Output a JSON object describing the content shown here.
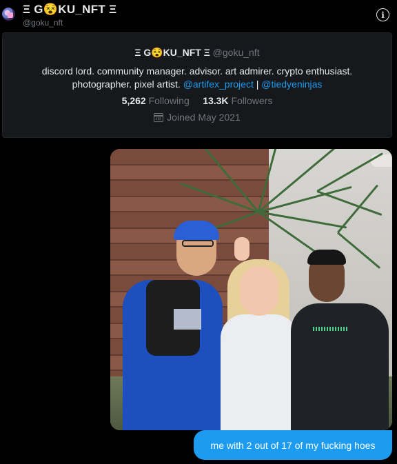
{
  "header": {
    "display_name": "Ξ G😵KU_NFT Ξ",
    "handle": "@goku_nft",
    "info_icon": "info-icon"
  },
  "profile": {
    "display_name": "Ξ G😵KU_NFT Ξ",
    "handle": "@goku_nft",
    "bio_line1": "discord lord. community manager. advisor. art admirer. crypto enthusiast.",
    "bio_line2_text": "photographer. pixel artist.",
    "link1": "@artifex_project",
    "separator": "|",
    "link2": "@tiedyeninjas",
    "following_count": "5,262",
    "following_label": "Following",
    "followers_count": "13.3K",
    "followers_label": "Followers",
    "joined": "Joined May 2021",
    "calendar_icon": "calendar-icon"
  },
  "message": {
    "caption": "me with 2 out of 17 of my fucking hoes"
  },
  "colors": {
    "background": "#000000",
    "card": "#16181c",
    "link": "#1d9bf0",
    "bubble": "#1d9bf0",
    "muted": "#71767b",
    "text": "#e7e9ea"
  }
}
